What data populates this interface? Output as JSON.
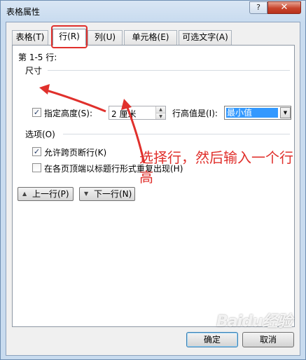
{
  "window": {
    "title": "表格属性",
    "help_label": "?",
    "close_label": "✕"
  },
  "tabs": [
    {
      "label": "表格(T)",
      "active": false
    },
    {
      "label": "行(R)",
      "active": true
    },
    {
      "label": "列(U)",
      "active": false
    },
    {
      "label": "单元格(E)",
      "active": false
    },
    {
      "label": "可选文字(A)",
      "active": false
    }
  ],
  "row_panel": {
    "rows_heading": "第 1-5 行:",
    "size_group": "尺寸",
    "specify_height": {
      "label": "指定高度(S):",
      "checked": true
    },
    "height_value": "2 厘米",
    "row_height_is_label": "行高值是(I):",
    "row_height_is_value": "最小值",
    "options_group": "选项(O)",
    "allow_break": {
      "label": "允许跨页断行(K)",
      "checked": true
    },
    "repeat_header": {
      "label": "在各页顶端以标题行形式重复出现(H)",
      "checked": false
    },
    "prev_row_label": "上一行(P)",
    "next_row_label": "下一行(N)"
  },
  "annotation": {
    "text": "选择行，然后输入一个行高",
    "color": "#e0302c"
  },
  "footer": {
    "ok_label": "确定",
    "cancel_label": "取消"
  },
  "watermark": "Baidu经验",
  "icons": {
    "checked_mark": "✓",
    "spin_up": "▲",
    "spin_down": "▼",
    "combo_arrow": "▼",
    "prev_arrow": "▲",
    "next_arrow": "▼"
  }
}
